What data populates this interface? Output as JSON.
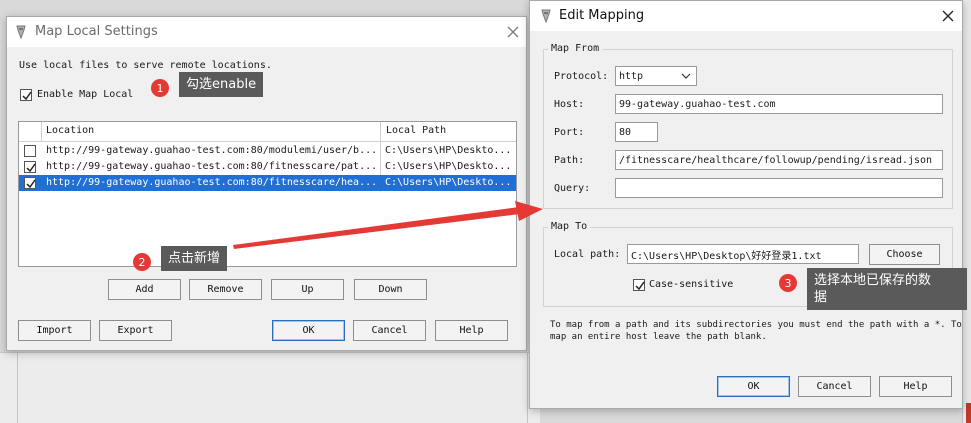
{
  "map_local": {
    "title": "Map Local Settings",
    "intro": "Use local files to serve remote locations.",
    "enable_label": "Enable Map Local",
    "enable_checked": true,
    "columns": [
      "Location",
      "Local Path"
    ],
    "rows": [
      {
        "checked": false,
        "location": "http://99-gateway.guahao-test.com:80/modulemi/user/b...",
        "local_path": "C:\\Users\\HP\\Deskto...",
        "selected": false
      },
      {
        "checked": true,
        "location": "http://99-gateway.guahao-test.com:80/fitnesscare/pat...",
        "local_path": "C:\\Users\\HP\\Deskto...",
        "selected": false
      },
      {
        "checked": true,
        "location": "http://99-gateway.guahao-test.com:80/fitnesscare/hea...",
        "local_path": "C:\\Users\\HP\\Deskto...",
        "selected": true
      }
    ],
    "buttons": {
      "add": "Add",
      "remove": "Remove",
      "up": "Up",
      "down": "Down",
      "import": "Import",
      "export": "Export",
      "ok": "OK",
      "cancel": "Cancel",
      "help": "Help"
    }
  },
  "edit_mapping": {
    "title": "Edit Mapping",
    "map_from_label": "Map From",
    "protocol_label": "Protocol:",
    "protocol_value": "http",
    "host_label": "Host:",
    "host_value": "99-gateway.guahao-test.com",
    "port_label": "Port:",
    "port_value": "80",
    "path_label": "Path:",
    "path_value": "/fitnesscare/healthcare/followup/pending/isread.json",
    "query_label": "Query:",
    "query_value": "",
    "map_to_label": "Map To",
    "local_path_label": "Local path:",
    "local_path_value": "C:\\Users\\HP\\Desktop\\好好登录1.txt",
    "choose_label": "Choose",
    "case_label": "Case-sensitive",
    "case_checked": true,
    "hint_line1": "To map from a path and its subdirectories you must end the path with a *. To",
    "hint_line2": "map an entire host leave the path blank.",
    "buttons": {
      "ok": "OK",
      "cancel": "Cancel",
      "help": "Help"
    }
  },
  "annotations": [
    {
      "number": "1",
      "text": "勾选enable"
    },
    {
      "number": "2",
      "text": "点击新增"
    },
    {
      "number": "3",
      "line1": "选择本地已保存的数",
      "line2": "据"
    }
  ],
  "colors": {
    "selection": "#1f6fd6",
    "badge": "#e53935",
    "arrow": "#e53935",
    "tooltip": "#5a5a5a"
  }
}
